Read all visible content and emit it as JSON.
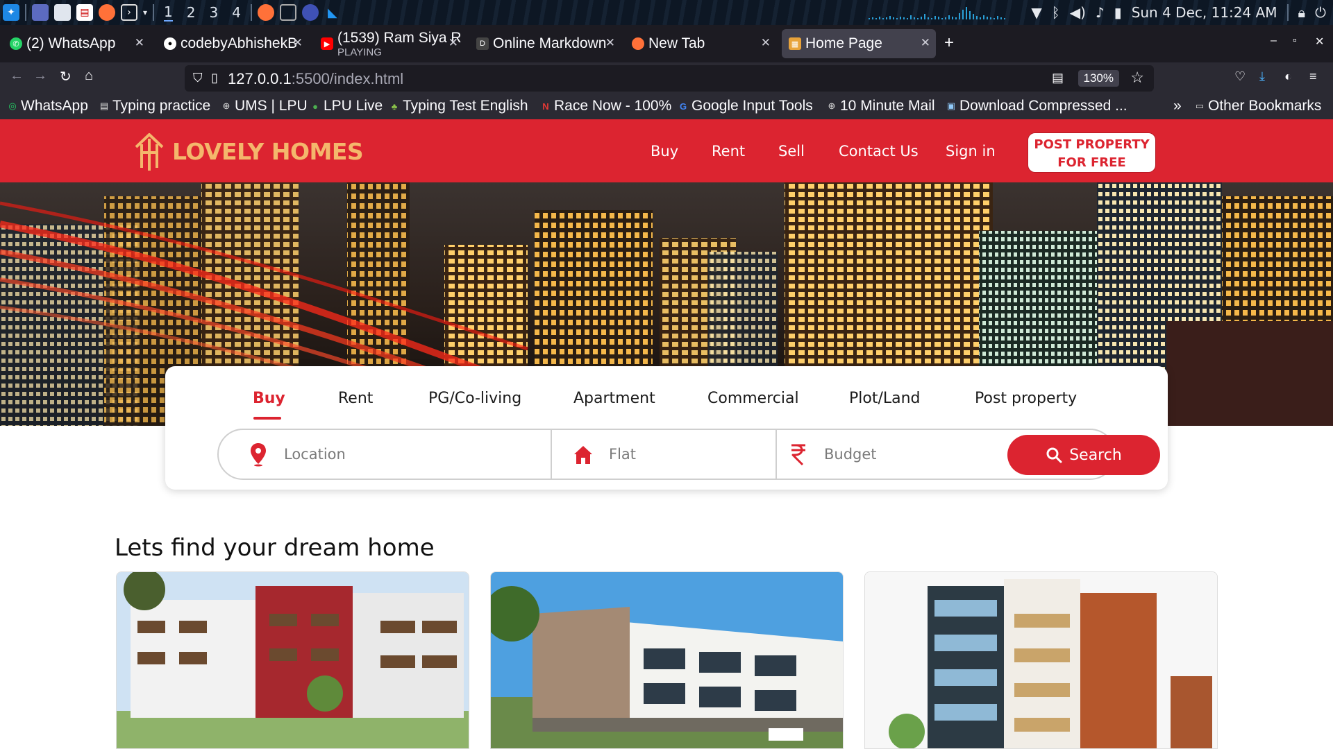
{
  "system_bar": {
    "workspaces": [
      "1",
      "2",
      "3",
      "4"
    ],
    "clock": "Sun  4 Dec, 11:24 AM"
  },
  "browser": {
    "tabs": [
      {
        "title": "(2) WhatsApp",
        "subtitle": "",
        "favicon_color": "#25d366"
      },
      {
        "title": "codebyAbhishekB",
        "subtitle": "",
        "favicon_color": "#ffffff"
      },
      {
        "title": "(1539) Ram Siya R",
        "subtitle": "PLAYING",
        "favicon_color": "#ff0000"
      },
      {
        "title": "Online Markdown",
        "subtitle": "",
        "favicon_color": "#444444"
      },
      {
        "title": "New Tab",
        "subtitle": "",
        "favicon_color": "#ff7139"
      },
      {
        "title": "Home Page",
        "subtitle": "",
        "favicon_color": "#e8a33a"
      }
    ],
    "url_host": "127.0.0.1",
    "url_rest": ":5500/index.html",
    "zoom": "130%",
    "bookmarks": [
      {
        "label": "WhatsApp",
        "icon": "whatsapp-icon",
        "color": "#25d366"
      },
      {
        "label": "Typing practice",
        "icon": "page-icon",
        "color": "#dddddd"
      },
      {
        "label": "UMS | LPU",
        "icon": "globe-icon",
        "color": "#dddddd"
      },
      {
        "label": "LPU Live",
        "icon": "chat-icon",
        "color": "#4caf50"
      },
      {
        "label": "Typing Test English",
        "icon": "leaf-icon",
        "color": "#8bc34a"
      },
      {
        "label": "Race Now - 100%",
        "icon": "n-icon",
        "color": "#e53935"
      },
      {
        "label": "Google Input Tools",
        "icon": "google-icon",
        "color": "#4285f4"
      },
      {
        "label": "10 Minute Mail",
        "icon": "globe-icon",
        "color": "#dddddd"
      },
      {
        "label": "Download Compressed ...",
        "icon": "doc-icon",
        "color": "#90caf9"
      }
    ],
    "other_bookmarks": "Other Bookmarks"
  },
  "site": {
    "brand": "LOVELY HOMES",
    "nav": [
      "Buy",
      "Rent",
      "Sell",
      "Contact Us",
      "Sign in"
    ],
    "post_button_line1": "POST PROPERTY",
    "post_button_line2": "FOR FREE",
    "accent": "#dc2430",
    "brand_color": "#f4b76c"
  },
  "search": {
    "tabs": [
      "Buy",
      "Rent",
      "PG/Co-living",
      "Apartment",
      "Commercial",
      "Plot/Land",
      "Post property"
    ],
    "active_tab": "Buy",
    "location_placeholder": "Location",
    "type_placeholder": "Flat",
    "budget_placeholder": "Budget",
    "button_label": "Search"
  },
  "content": {
    "section_title": "Lets find your dream home",
    "cards": [
      "apartment-building-1",
      "apartment-building-2",
      "apartment-building-3"
    ]
  }
}
